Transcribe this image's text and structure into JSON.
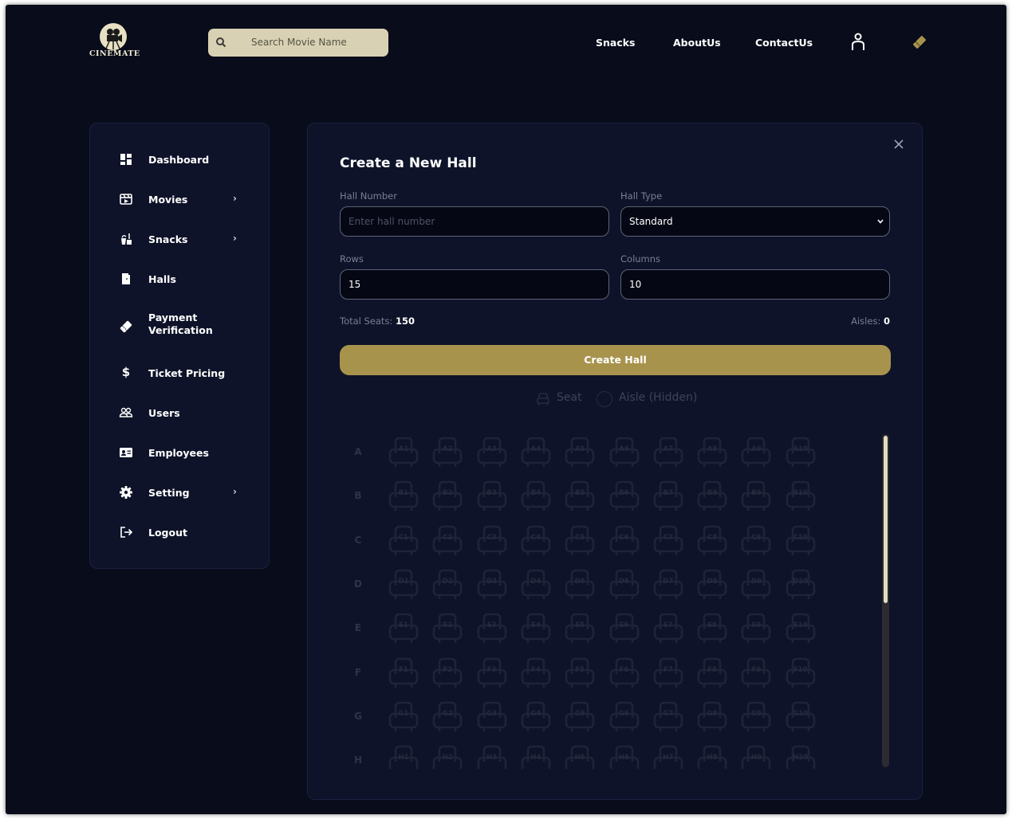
{
  "header": {
    "logo_text": "CINEMATE",
    "search_placeholder": "Search Movie Name",
    "nav": [
      "Snacks",
      "AboutUs",
      "ContactUs"
    ]
  },
  "sidebar": {
    "items": [
      {
        "label": "Dashboard",
        "icon": "dashboard-icon",
        "chevron": false
      },
      {
        "label": "Movies",
        "icon": "movies-icon",
        "chevron": true
      },
      {
        "label": "Snacks",
        "icon": "snacks-icon",
        "chevron": true
      },
      {
        "label": "Halls",
        "icon": "halls-icon",
        "chevron": false
      },
      {
        "label": "Payment Verification",
        "icon": "payment-icon",
        "chevron": false
      },
      {
        "label": "Ticket Pricing",
        "icon": "dollar-icon",
        "chevron": false
      },
      {
        "label": "Users",
        "icon": "users-icon",
        "chevron": false
      },
      {
        "label": "Employees",
        "icon": "id-card-icon",
        "chevron": false
      },
      {
        "label": "Setting",
        "icon": "gear-icon",
        "chevron": true
      },
      {
        "label": "Logout",
        "icon": "logout-icon",
        "chevron": false
      }
    ],
    "chevron_glyph": "›"
  },
  "form": {
    "title": "Create a New Hall",
    "hall_number_label": "Hall Number",
    "hall_number_placeholder": "Enter hall number",
    "hall_type_label": "Hall Type",
    "hall_type_value": "Standard",
    "rows_label": "Rows",
    "rows_value": "15",
    "columns_label": "Columns",
    "columns_value": "10",
    "total_seats_label": "Total Seats:",
    "total_seats_value": "150",
    "aisles_label": "Aisles:",
    "aisles_value": "0",
    "create_button": "Create Hall",
    "legend_seat": "Seat",
    "legend_aisle": "Aisle (Hidden)"
  },
  "seat_map": {
    "rows": [
      "A",
      "B",
      "C",
      "D",
      "E",
      "F",
      "G",
      "H"
    ],
    "columns": 10
  },
  "colors": {
    "background": "#090c1a",
    "panel": "#0e1329",
    "accent": "#a8934d",
    "search_bg": "#d9d1b3"
  }
}
